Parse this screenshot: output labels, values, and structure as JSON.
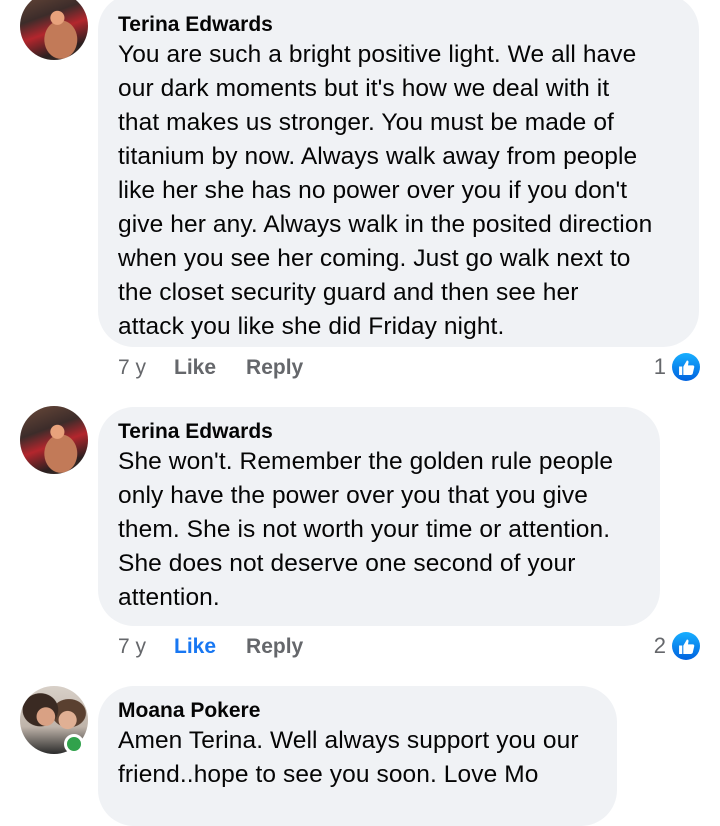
{
  "comments": [
    {
      "author": "Terina Edwards",
      "lines": [
        "You are such a bright positive light. We all have",
        "our dark moments but it's how we deal with it",
        "that makes us stronger. You must be made of",
        "titanium by now. Always walk away from people",
        "like her she has no power over you if you don't",
        "give her any. Always walk in the posited direction",
        "when you see her coming. Just go walk next to",
        "the closet security guard and then see her",
        "attack you like she did Friday night."
      ],
      "time": "7 y",
      "like_label": "Like",
      "reply_label": "Reply",
      "reaction_count": "1",
      "reaction_icon": "thumbs-up-icon"
    },
    {
      "author": "Terina Edwards",
      "lines": [
        "She won't. Remember the golden rule people",
        "only have the power over you that you give",
        "them. She is not worth your time or attention.",
        "She does not deserve one second of your",
        "attention."
      ],
      "time": "7 y",
      "like_label": "Like",
      "reply_label": "Reply",
      "reaction_count": "2",
      "reaction_icon": "thumbs-up-icon",
      "liked": true
    },
    {
      "author": "Moana Pokere",
      "lines": [
        "Amen Terina. Well always support you our",
        "friend..hope to see you soon. Love Mo"
      ],
      "online": true
    }
  ],
  "colors": {
    "bubble": "#f0f2f5",
    "meta_text": "#65676b",
    "like_active": "#1877f2",
    "online": "#31a24c"
  }
}
